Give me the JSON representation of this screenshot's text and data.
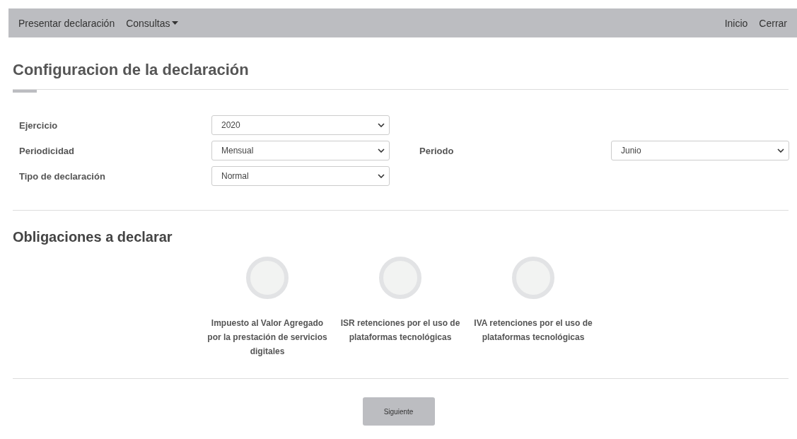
{
  "navbar": {
    "left": [
      {
        "label": "Presentar declaración",
        "kind": "link"
      },
      {
        "label": "Consultas",
        "kind": "dropdown"
      }
    ],
    "right": [
      {
        "label": "Inicio",
        "kind": "link"
      },
      {
        "label": "Cerrar",
        "kind": "link"
      }
    ]
  },
  "title": "Configuracion de la declaración",
  "form": {
    "rows": [
      [
        {
          "label": "Ejercicio",
          "value": "2020"
        }
      ],
      [
        {
          "label": "Periodicidad",
          "value": "Mensual"
        },
        {
          "label": "Periodo",
          "value": "Junio"
        }
      ],
      [
        {
          "label": "Tipo de declaración",
          "value": "Normal"
        }
      ]
    ]
  },
  "obligations": {
    "heading": "Obligaciones a declarar",
    "items": [
      {
        "label": "Impuesto al Valor Agregado por la prestación de servicios digitales",
        "selected": false
      },
      {
        "label": "ISR retenciones por el uso de plataformas tecnológicas",
        "selected": false
      },
      {
        "label": "IVA retenciones por el uso de plataformas tecnológicas",
        "selected": false
      }
    ]
  },
  "next_button": "Siguiente"
}
